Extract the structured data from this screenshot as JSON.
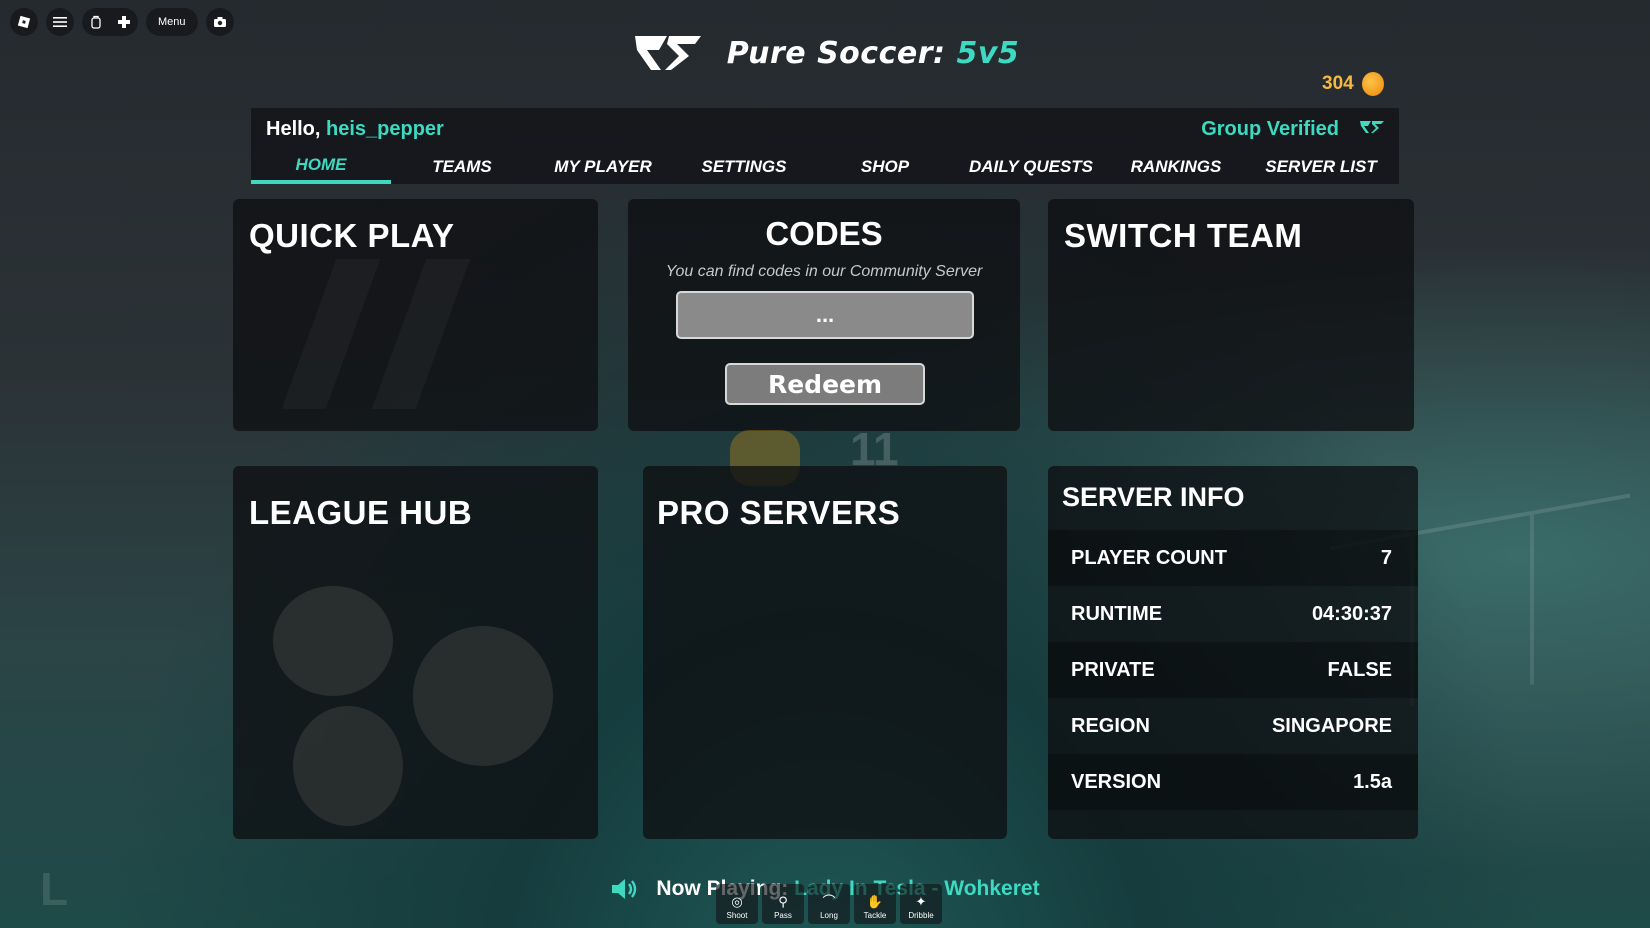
{
  "roblox_bar": {
    "menu_label": "Menu",
    "icons": [
      "roblox-logo-icon",
      "hamburger-icon",
      "backpack-icon",
      "plus-icon",
      "camera-icon"
    ]
  },
  "game": {
    "title_main": "Pure Soccer:",
    "title_accent": "5v5",
    "accent_color": "#3dd9c1"
  },
  "coins": {
    "count": "304"
  },
  "header": {
    "greeting": "Hello,",
    "username": "heis_pepper",
    "verified_label": "Group Verified"
  },
  "nav": {
    "tabs": [
      {
        "label": "HOME",
        "active": true
      },
      {
        "label": "TEAMS"
      },
      {
        "label": "MY PLAYER"
      },
      {
        "label": "SETTINGS"
      },
      {
        "label": "SHOP"
      },
      {
        "label": "DAILY QUESTS"
      },
      {
        "label": "RANKINGS"
      },
      {
        "label": "SERVER LIST"
      }
    ]
  },
  "cards": {
    "quick_play": "QUICK PLAY",
    "switch_team": "SWITCH TEAM",
    "league_hub": "LEAGUE HUB",
    "pro_servers": "PRO SERVERS"
  },
  "codes": {
    "title": "CODES",
    "subtitle": "You can find codes in our Community Server",
    "input_value": "...",
    "redeem_label": "Redeem"
  },
  "background": {
    "ghost_number": "11"
  },
  "server_info": {
    "title": "SERVER INFO",
    "rows": [
      {
        "label": "PLAYER COUNT",
        "value": "7"
      },
      {
        "label": "RUNTIME",
        "value": "04:30:37"
      },
      {
        "label": "PRIVATE",
        "value": "FALSE"
      },
      {
        "label": "REGION",
        "value": "SINGAPORE"
      },
      {
        "label": "VERSION",
        "value": "1.5a"
      }
    ]
  },
  "now_playing": {
    "label": "Now Playing:",
    "track": "Lady In Tesla - Wohkeret"
  },
  "controls": [
    {
      "label": "Shoot",
      "icon": "shoot-icon"
    },
    {
      "label": "Pass",
      "icon": "pass-icon"
    },
    {
      "label": "Long",
      "icon": "long-icon"
    },
    {
      "label": "Tackle",
      "icon": "tackle-icon"
    },
    {
      "label": "Dribble",
      "icon": "dribble-icon"
    }
  ],
  "corner_letter": "L"
}
